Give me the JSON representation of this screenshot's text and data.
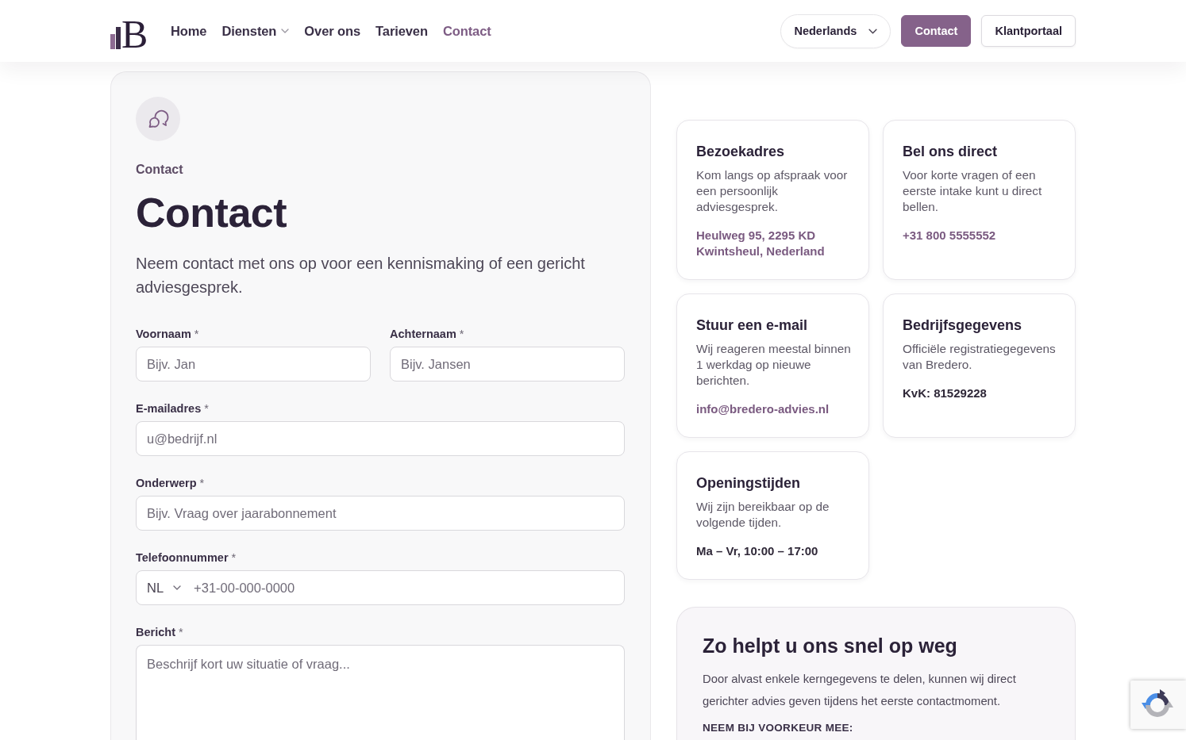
{
  "header": {
    "logo": {
      "letter": "B"
    },
    "nav": [
      {
        "label": "Home",
        "kind": "link",
        "selected": false
      },
      {
        "label": "Diensten",
        "kind": "dropdown",
        "selected": false
      },
      {
        "label": "Over ons",
        "kind": "link",
        "selected": false
      },
      {
        "label": "Tarieven",
        "kind": "link",
        "selected": false
      },
      {
        "label": "Contact",
        "kind": "link",
        "selected": true
      }
    ],
    "language": {
      "value": "Nederlands"
    },
    "buttons": [
      {
        "label": "Contact",
        "kind": "primary"
      },
      {
        "label": "Klantportaal",
        "kind": "outline"
      }
    ]
  },
  "form_card": {
    "eyebrow": "Contact",
    "title": "Contact",
    "intro": "Neem contact met ons op voor een kennismaking of een gericht adviesgesprek.",
    "rows": [
      [
        {
          "kind": "text",
          "label": "Voornaam",
          "required_mark": "*",
          "placeholder": "Bijv. Jan"
        },
        {
          "kind": "text",
          "label": "Achternaam",
          "required_mark": "*",
          "placeholder": "Bijv. Jansen"
        }
      ],
      [
        {
          "kind": "text",
          "label": "E-mailadres",
          "required_mark": "*",
          "placeholder": "u@bedrijf.nl"
        }
      ],
      [
        {
          "kind": "text",
          "label": "Onderwerp",
          "required_mark": "*",
          "placeholder": "Bijv. Vraag over jaarabonnement"
        }
      ],
      [
        {
          "kind": "phone",
          "label": "Telefoonnummer",
          "required_mark": "*",
          "country": "NL",
          "placeholder": "+31-00-000-0000"
        }
      ],
      [
        {
          "kind": "textarea",
          "label": "Bericht",
          "required_mark": "*",
          "placeholder": "Beschrijf kort uw situatie of vraag..."
        }
      ]
    ]
  },
  "info_cards": [
    {
      "title": "Bezoekadres",
      "description": "Kom langs op afspraak voor een persoonlijk adviesgesprek.",
      "detail": {
        "text": "Heulweg 95, 2295 KD Kwintsheul, Nederland",
        "kind": "link"
      }
    },
    {
      "title": "Bel ons direct",
      "description": "Voor korte vragen of een eerste intake kunt u direct bellen.",
      "detail": {
        "text": "+31 800 5555552",
        "kind": "link"
      }
    },
    {
      "title": "Stuur een e-mail",
      "description": "Wij reageren meestal binnen 1 werkdag op nieuwe berichten.",
      "detail": {
        "text": "info@bredero-advies.nl",
        "kind": "link"
      }
    },
    {
      "title": "Bedrijfsgegevens",
      "description": "Officiële registratiegegevens van Bredero.",
      "detail": {
        "text": "KvK: 81529228",
        "kind": "plain"
      }
    },
    {
      "title": "Openingstijden",
      "description": "Wij zijn bereikbaar op de volgende tijden.",
      "detail": {
        "text": "Ma – Vr, 10:00 – 17:00",
        "kind": "plain"
      }
    }
  ],
  "help_panel": {
    "title": "Zo helpt u ons snel op weg",
    "text": "Door alvast enkele kerngegevens te delen, kunnen wij direct gerichter advies geven tijdens het eerste contactmoment.",
    "list_heading": "NEEM BIJ VOORKEUR MEE:"
  }
}
